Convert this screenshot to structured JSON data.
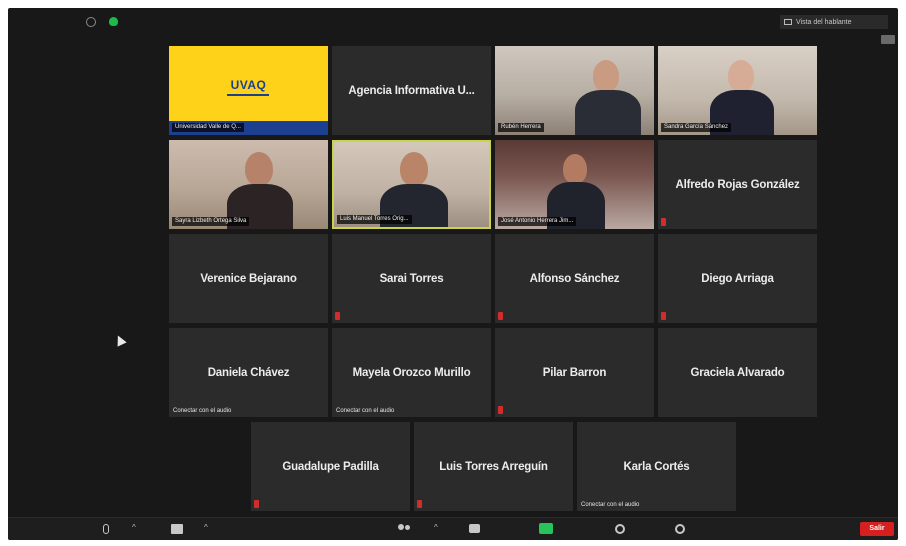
{
  "window": {
    "view_button": "Vista del hablante"
  },
  "participants": {
    "p1": {
      "label": "Universidad Valle de Q..."
    },
    "p2": {
      "name": "Agencia Informativa U..."
    },
    "p3": {
      "label": "Rubén Herrera"
    },
    "p4": {
      "label": "Sandra García Sánchez"
    },
    "p5": {
      "label": "Sayra Lizbeth Ortega Silva"
    },
    "p6": {
      "label": "Luis Manuel Torres Orig..."
    },
    "p7": {
      "label": "José Antonio Herrera Jim..."
    },
    "p8": {
      "name": "Alfredo Rojas González"
    },
    "p9": {
      "name": "Verenice Bejarano"
    },
    "p10": {
      "name": "Sarai Torres"
    },
    "p11": {
      "name": "Alfonso Sánchez"
    },
    "p12": {
      "name": "Diego Arriaga"
    },
    "p13": {
      "name": "Daniela Chávez",
      "audio": "Conectar con el audio"
    },
    "p14": {
      "name": "Mayela Orozco Murillo",
      "audio": "Conectar con el audio"
    },
    "p15": {
      "name": "Pilar Barron"
    },
    "p16": {
      "name": "Graciela Alvarado"
    },
    "p17": {
      "name": "Guadalupe Padilla"
    },
    "p18": {
      "name": "Luis Torres Arreguín"
    },
    "p19": {
      "name": "Karla Cortés",
      "audio": "Conectar con el audio"
    }
  },
  "logo_text": "UVAQ",
  "toolbar": {
    "leave_label": "Salir"
  },
  "colors": {
    "active_speaker": "#c9d44a",
    "leave": "#d62020",
    "share": "#26c45a",
    "mute": "#d22d2d",
    "uvaq_yellow": "#ffd21a",
    "uvaq_blue": "#1d3f8f"
  }
}
